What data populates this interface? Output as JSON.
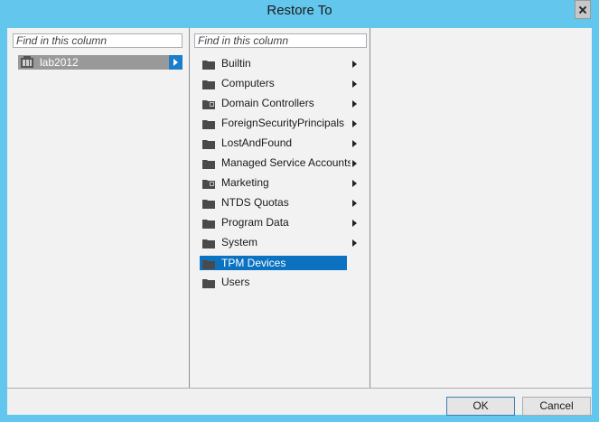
{
  "window": {
    "title": "Restore To"
  },
  "column1": {
    "search_placeholder": "Find in this column",
    "items": [
      {
        "label": "lab2012",
        "icon": "domain-icon",
        "selected": true
      }
    ]
  },
  "column2": {
    "search_placeholder": "Find in this column",
    "items": [
      {
        "label": "Builtin",
        "icon": "folder-icon",
        "has_children": true
      },
      {
        "label": "Computers",
        "icon": "folder-icon",
        "has_children": true
      },
      {
        "label": "Domain Controllers",
        "icon": "ou-folder-icon",
        "has_children": true
      },
      {
        "label": "ForeignSecurityPrincipals",
        "icon": "folder-icon",
        "has_children": true
      },
      {
        "label": "LostAndFound",
        "icon": "folder-icon",
        "has_children": true
      },
      {
        "label": "Managed Service Accounts",
        "icon": "folder-icon",
        "has_children": true
      },
      {
        "label": "Marketing",
        "icon": "ou-folder-icon",
        "has_children": true
      },
      {
        "label": "NTDS Quotas",
        "icon": "folder-icon",
        "has_children": true
      },
      {
        "label": "Program Data",
        "icon": "folder-icon",
        "has_children": true
      },
      {
        "label": "System",
        "icon": "folder-icon",
        "has_children": true
      },
      {
        "label": "TPM Devices",
        "icon": "folder-icon",
        "has_children": false,
        "selected": true
      },
      {
        "label": "Users",
        "icon": "folder-icon",
        "has_children": false
      }
    ]
  },
  "buttons": {
    "ok": "OK",
    "cancel": "Cancel"
  },
  "colors": {
    "title_bar": "#63c6ec",
    "selection": "#0b72c2",
    "root_selection": "#999999"
  }
}
